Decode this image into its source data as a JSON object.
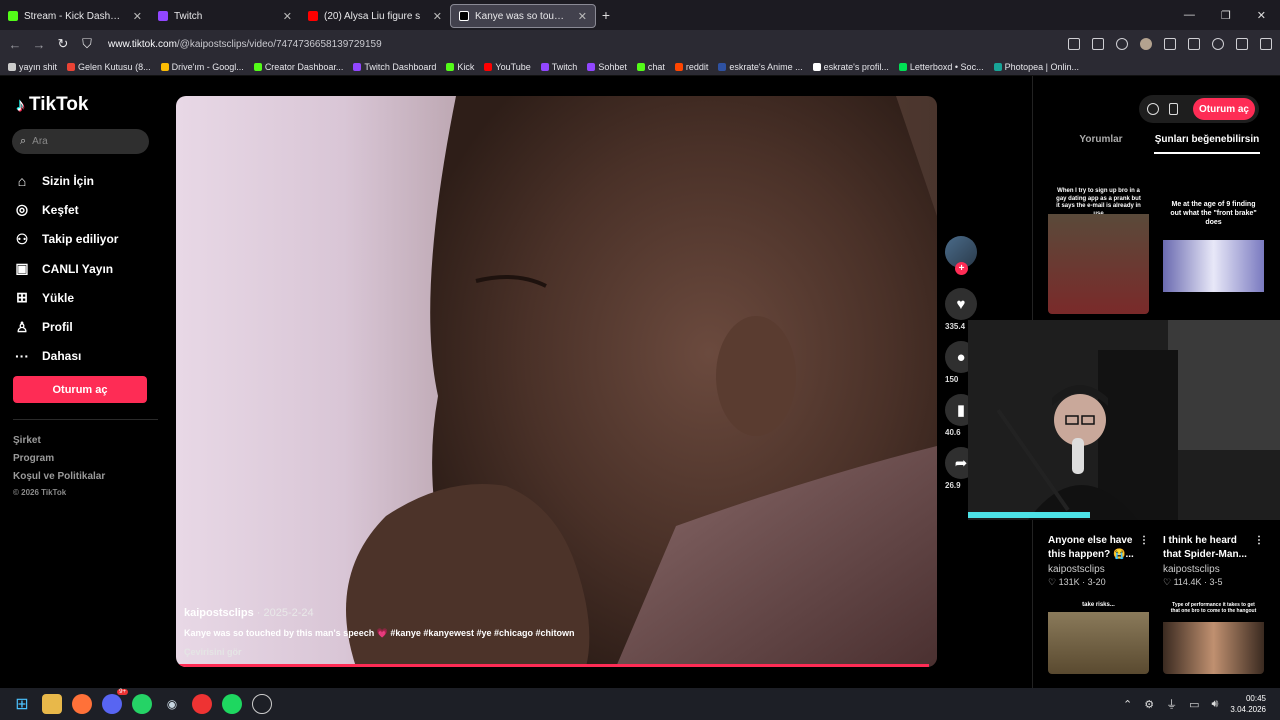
{
  "browser": {
    "tabs": [
      {
        "title": "Stream - Kick Dashboard",
        "icon": "kick-icon",
        "color": "#53fc18",
        "active": false
      },
      {
        "title": "Twitch",
        "icon": "twitch-icon",
        "color": "#9146ff",
        "active": false
      },
      {
        "title": "(20) Alysa Liu figure s",
        "icon": "youtube-icon",
        "color": "#ff0000",
        "active": false
      },
      {
        "title": "Kanye was so touched",
        "icon": "tiktok-icon",
        "color": "#ffffff",
        "active": true
      }
    ],
    "url_host": "www.tiktok.com",
    "url_path": "/@kaipostsclips/video/7474736658139729159",
    "bookmarks": [
      {
        "label": "yayın shit",
        "color": "#cccccc"
      },
      {
        "label": "Gelen Kutusu (8...",
        "color": "#ea4335"
      },
      {
        "label": "Drive'ım - Googl...",
        "color": "#fbbc04"
      },
      {
        "label": "Creator Dashboar...",
        "color": "#53fc18"
      },
      {
        "label": "Twitch Dashboard",
        "color": "#9146ff"
      },
      {
        "label": "Kick",
        "color": "#53fc18"
      },
      {
        "label": "YouTube",
        "color": "#ff0000"
      },
      {
        "label": "Twitch",
        "color": "#9146ff"
      },
      {
        "label": "Sohbet",
        "color": "#9146ff"
      },
      {
        "label": "chat",
        "color": "#53fc18"
      },
      {
        "label": "reddit",
        "color": "#ff4500"
      },
      {
        "label": "eskrate's Anime ...",
        "color": "#2e51a2"
      },
      {
        "label": "eskrate's profil...",
        "color": "#ffffff"
      },
      {
        "label": "Letterboxd • Soc...",
        "color": "#00e054"
      },
      {
        "label": "Photopea | Onlin...",
        "color": "#18a497"
      }
    ]
  },
  "sidebar": {
    "brand": "TikTok",
    "search_placeholder": "Ara",
    "items": [
      {
        "label": "Sizin İçin",
        "icon": "home-icon",
        "glyph": "⌂"
      },
      {
        "label": "Keşfet",
        "icon": "compass-icon",
        "glyph": "◎"
      },
      {
        "label": "Takip ediliyor",
        "icon": "following-icon",
        "glyph": "⚇"
      },
      {
        "label": "CANLI Yayın",
        "icon": "live-icon",
        "glyph": "▣"
      },
      {
        "label": "Yükle",
        "icon": "upload-icon",
        "glyph": "⊞"
      },
      {
        "label": "Profil",
        "icon": "profile-icon",
        "glyph": "♙"
      },
      {
        "label": "Dahası",
        "icon": "more-icon",
        "glyph": "···"
      }
    ],
    "login_label": "Oturum aç",
    "footer_links": [
      "Şirket",
      "Program",
      "Koşul ve Politikalar"
    ],
    "copyright": "© 2026 TikTok"
  },
  "video": {
    "username": "kaipostsclips",
    "date": "2025-2-24",
    "description": "Kanye was so touched by this man's speech 💗 #kanye #kanyewest #ye #chicago #chitown",
    "translation_label": "Çevirisini gör",
    "progress": 0.99
  },
  "actions": {
    "likes": "335.4",
    "comments": "150",
    "saves": "40.6",
    "shares": "26.9"
  },
  "right_panel": {
    "login_label": "Oturum aç",
    "tabs": [
      "Yorumlar",
      "Şunları beğenebilirsin"
    ],
    "cards": [
      {
        "caption": "When I try to sign up bro in a gay dating app as a prank but it says the e-mail is already in use"
      },
      {
        "caption": "Me at the age of 9 finding out what the \"front brake\" does"
      },
      {
        "title": "Anyone else have this happen? 😭...",
        "user": "kaipostsclips",
        "likes": "131K",
        "date": "3-20",
        "caption": "take risks..."
      },
      {
        "title": "I think he heard that Spider-Man...",
        "user": "kaipostsclips",
        "likes": "114.4K",
        "date": "3-5",
        "caption": "Type of performance it takes to get that one bro to come to the hangout"
      }
    ]
  },
  "taskbar": {
    "time": "00:45",
    "date": "3.04.2026",
    "discord_badge": "9+"
  },
  "colors": {
    "accent": "#fe2c55",
    "cam_bar": "#4de2e6"
  }
}
